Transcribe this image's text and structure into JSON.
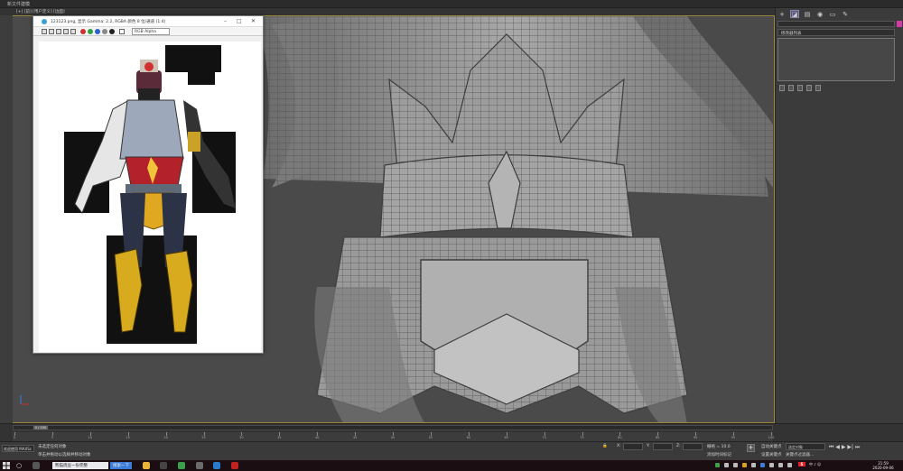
{
  "window": {
    "title": "新文件建模"
  },
  "viewport": {
    "label": "[+] [前] [用户定义] [边面]"
  },
  "image_viewer": {
    "title": "123123.png, 显示 Gamma: 2.2, RGBA 颜色 8 位/通道 (1:4)",
    "channel_select": "RGB Alpha"
  },
  "command_panel": {
    "dropdown": "修改器列表"
  },
  "timeline": {
    "frame_display": "0 / 100",
    "ruler_ticks": [
      "0",
      "5",
      "10",
      "15",
      "20",
      "25",
      "30",
      "35",
      "40",
      "45",
      "50",
      "55",
      "60",
      "65",
      "70",
      "75",
      "80",
      "85",
      "90",
      "95",
      "100"
    ]
  },
  "statusbar": {
    "script_box": "欢迎使用 MAXSc",
    "message_top": "未选定任何对象",
    "message_bottom": "单击并拖动以选择并移动对象",
    "coord_x": "X:",
    "coord_y": "Y:",
    "coord_z": "Z:",
    "grid": "栅格 = 10.0",
    "add_tag": "添加时间标记",
    "auto_key": "自动关键点",
    "set_key": "设置关键点",
    "selected": "选定对象",
    "key_filters": "关键点过滤器..."
  },
  "taskbar": {
    "task_1": "熊猫烧豆一份完整",
    "task_2": "搜索一下",
    "clock_time": "21:59",
    "clock_date": "2020-09-06",
    "ime": "S",
    "tray_text": "中 ♪ ☺"
  },
  "colors": {
    "viewport_bg": "#4a4a4a",
    "mesh_fill": "#8c8c8c",
    "mesh_line": "#3d3d3d",
    "active_border": "#9a8a3a",
    "taskbar": "#1b0e12",
    "accent_pink": "#d53aa8"
  }
}
